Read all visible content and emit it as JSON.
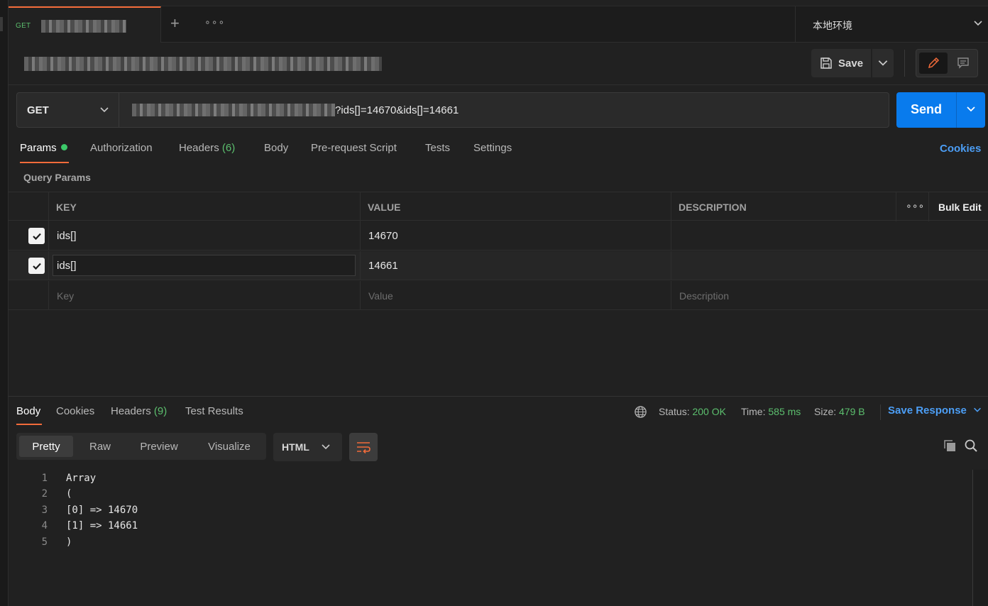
{
  "tab": {
    "method": "GET"
  },
  "environment": {
    "name": "本地环境"
  },
  "toolbar": {
    "save_label": "Save"
  },
  "request": {
    "method": "GET",
    "url_visible": "?ids[]=14670&ids[]=14661",
    "send_label": "Send"
  },
  "request_tabs": {
    "params": "Params",
    "authorization": "Authorization",
    "headers": "Headers",
    "headers_count": "(6)",
    "body": "Body",
    "prerequest": "Pre-request Script",
    "tests": "Tests",
    "settings": "Settings",
    "cookies": "Cookies"
  },
  "query_params": {
    "title": "Query Params",
    "columns": {
      "key": "KEY",
      "value": "VALUE",
      "description": "DESCRIPTION",
      "more": "∘∘∘",
      "bulk_edit": "Bulk Edit"
    },
    "rows": [
      {
        "key": "ids[]",
        "value": "14670",
        "description": "",
        "checked": true
      },
      {
        "key": "ids[]",
        "value": "14661",
        "description": "",
        "checked": true
      }
    ],
    "placeholders": {
      "key": "Key",
      "value": "Value",
      "description": "Description"
    }
  },
  "response_tabs": {
    "body": "Body",
    "cookies": "Cookies",
    "headers": "Headers",
    "headers_count": "(9)",
    "test_results": "Test Results"
  },
  "response_status": {
    "status_label": "Status:",
    "status_value": "200 OK",
    "time_label": "Time:",
    "time_value": "585 ms",
    "size_label": "Size:",
    "size_value": "479 B",
    "save_response": "Save Response"
  },
  "response_view": {
    "modes": [
      "Pretty",
      "Raw",
      "Preview",
      "Visualize"
    ],
    "active_mode": "Pretty",
    "format": "HTML"
  },
  "response_body": {
    "lines": [
      {
        "n": "1",
        "text": "Array"
      },
      {
        "n": "2",
        "text": "("
      },
      {
        "n": "3",
        "text": "[0] => 14670"
      },
      {
        "n": "4",
        "text": "[1] => 14661"
      },
      {
        "n": "5",
        "text": ")"
      }
    ]
  },
  "colors": {
    "accent": "#f26b3a",
    "send": "#097bed",
    "success": "#5cbf6e",
    "link": "#4c9ef5",
    "background": "#212121"
  }
}
